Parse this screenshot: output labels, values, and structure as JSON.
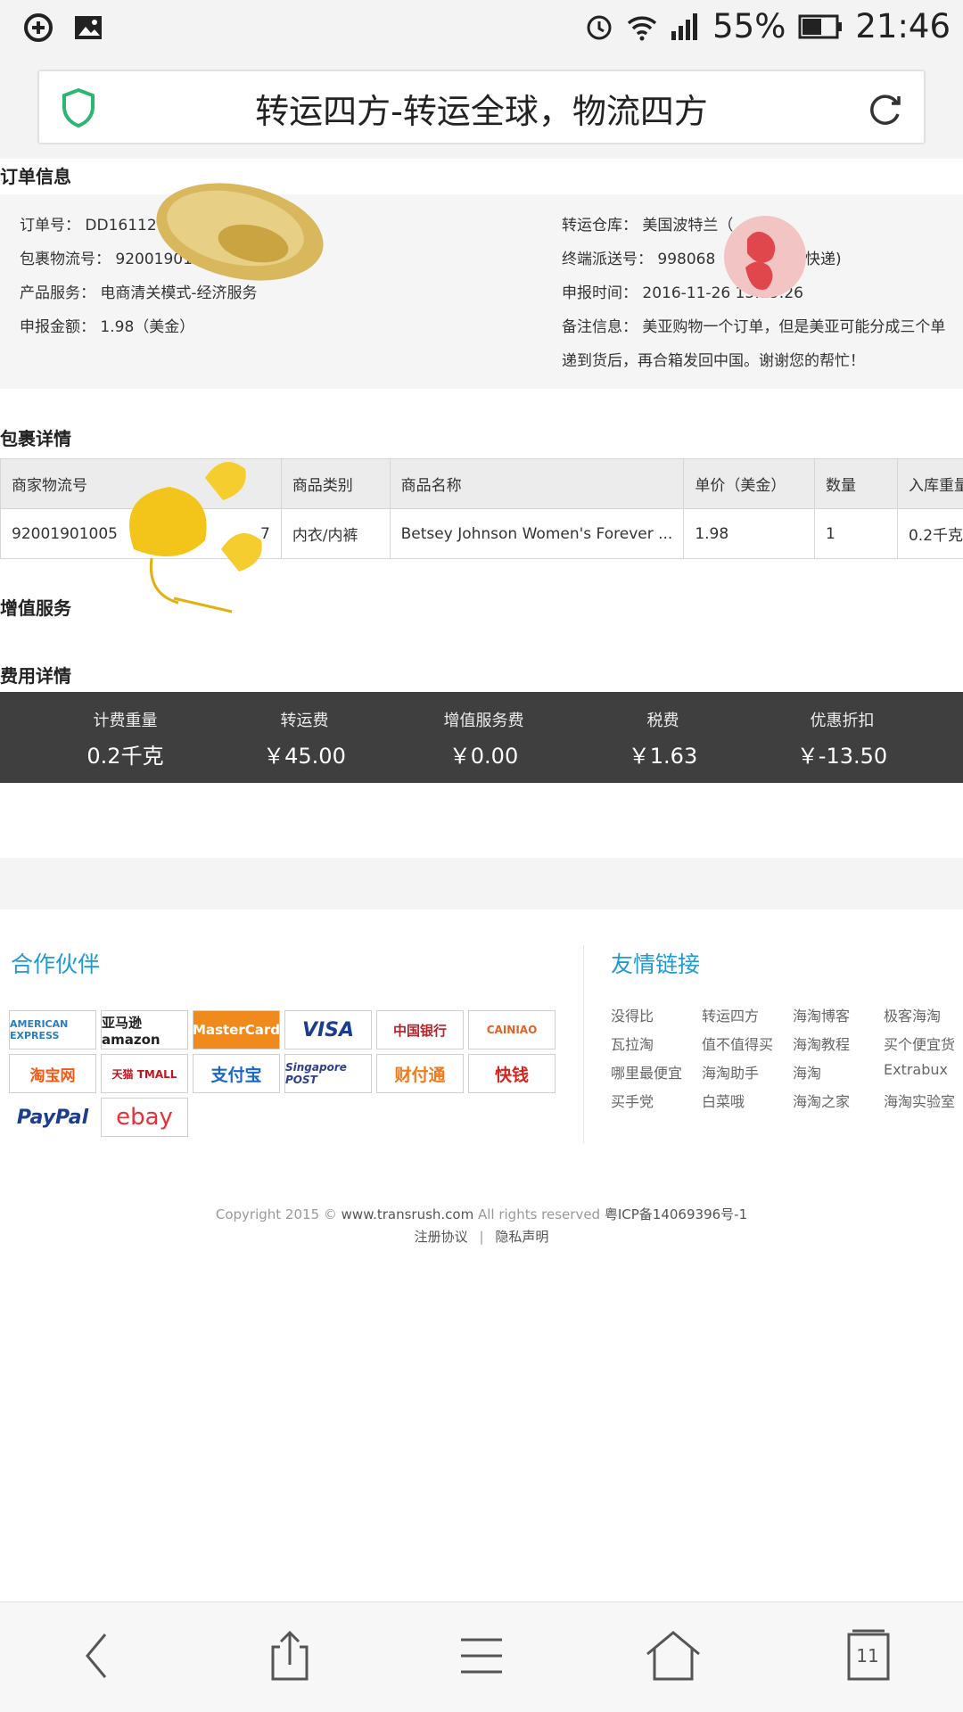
{
  "status_bar": {
    "battery": "55%",
    "time": "21:46"
  },
  "browser": {
    "page_title": "转运四方-转运全球，物流四方",
    "tab_count": "11"
  },
  "order_info": {
    "title": "订单信息",
    "order_no": "订单号：  DD16112",
    "tracking_no": "包裹物流号：  92001901005",
    "product_service": "产品服务：  电商清关模式-经济服务",
    "declared_amount": "申报金额：  1.98（美金）",
    "warehouse": "转运仓库：  美国波特兰（",
    "delivery_no": "终端派送号：  998068",
    "delivery_suffix": "快递)",
    "declare_time": "申报时间：  2016-11-26 13:15:26",
    "remark_line1": "备注信息：  美亚购物一个订单，但是美亚可能分成三个单",
    "remark_line2": "递到货后，再合箱发回中国。谢谢您的帮忙！"
  },
  "package_detail": {
    "title": "包裹详情",
    "headers": [
      "商家物流号",
      "商品类别",
      "商品名称",
      "单价（美金）",
      "数量",
      "入库重量"
    ],
    "rows": [
      [
        "92001901005",
        "内衣/内裤",
        "Betsey Johnson Women's Forever ...",
        "1.98",
        "1",
        "0.2千克"
      ]
    ],
    "row_tail": "7"
  },
  "value_added": {
    "title": "增值服务"
  },
  "fees": {
    "title": "费用详情",
    "items": [
      {
        "label": "计费重量",
        "value": "0.2千克"
      },
      {
        "label": "转运费",
        "value": "￥45.00"
      },
      {
        "label": "增值服务费",
        "value": "￥0.00"
      },
      {
        "label": "税费",
        "value": "￥1.63"
      },
      {
        "label": "优惠折扣",
        "value": "￥-13.50"
      }
    ]
  },
  "partners": {
    "title": "合作伙伴",
    "logos": [
      "AMERICAN EXPRESS",
      "亚马逊 amazon",
      "MasterCard",
      "VISA",
      "中国银行",
      "CAINIAO",
      "淘宝网",
      "天猫 TMALL",
      "支付宝",
      "Singapore POST",
      "财付通",
      "快钱",
      "PayPal",
      "ebay"
    ]
  },
  "links": {
    "title": "友情链接",
    "items": [
      "没得比",
      "转运四方",
      "海淘博客",
      "极客海淘",
      "瓦拉淘",
      "值不值得买",
      "海淘教程",
      "买个便宜货",
      "哪里最便宜",
      "海淘助手",
      "海淘",
      "Extrabux",
      "买手党",
      "白菜哦",
      "海淘之家",
      "海淘实验室"
    ]
  },
  "footer": {
    "copyright": "Copyright 2015 © ",
    "site": "www.transrush.com",
    "rights": " All rights reserved ",
    "icp": "粤ICP备14069396号-1",
    "register": "注册协议",
    "sep": "|",
    "privacy": "隐私声明"
  },
  "colors": {
    "accent": "#1f9bd1",
    "fee_bar": "#3f3f3f",
    "shield": "#2bb673"
  }
}
